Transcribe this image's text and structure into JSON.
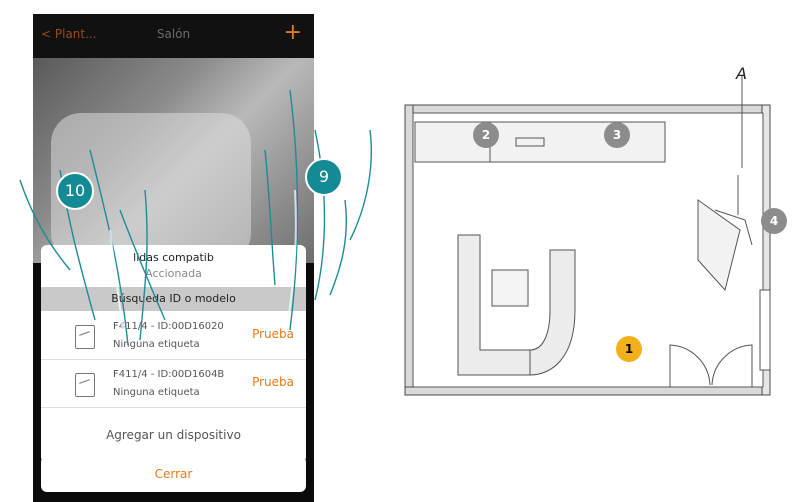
{
  "phone": {
    "back_label": "Plant...",
    "title": "Salón",
    "plus_label": "+",
    "card": {
      "line1": "lidas compatib",
      "line2": "Accionada",
      "search_label": "Búsqueda    ID o modelo",
      "devices": [
        {
          "name": "F411/4 - ID:00D16020",
          "label": "Ninguna etiqueta",
          "test_label": "Prueba"
        },
        {
          "name": "F411/4 - ID:00D1604B",
          "label": "Ninguna etiqueta",
          "test_label": "Prueba"
        }
      ],
      "add_label": "Agregar un dispositivo"
    },
    "close_label": "Cerrar"
  },
  "steps": [
    {
      "label": "10"
    },
    {
      "label": "9"
    }
  ],
  "floorplan": {
    "bulbs": [
      {
        "label": "1",
        "state": "on"
      },
      {
        "label": "2",
        "state": "off"
      },
      {
        "label": "3",
        "state": "off"
      },
      {
        "label": "4",
        "state": "off"
      }
    ],
    "area_label": "A"
  },
  "colors": {
    "accent": "#e07a1c",
    "badge": "#138a94",
    "bulb_on": "#f2b11a",
    "bulb_off": "#8c8c8c"
  }
}
